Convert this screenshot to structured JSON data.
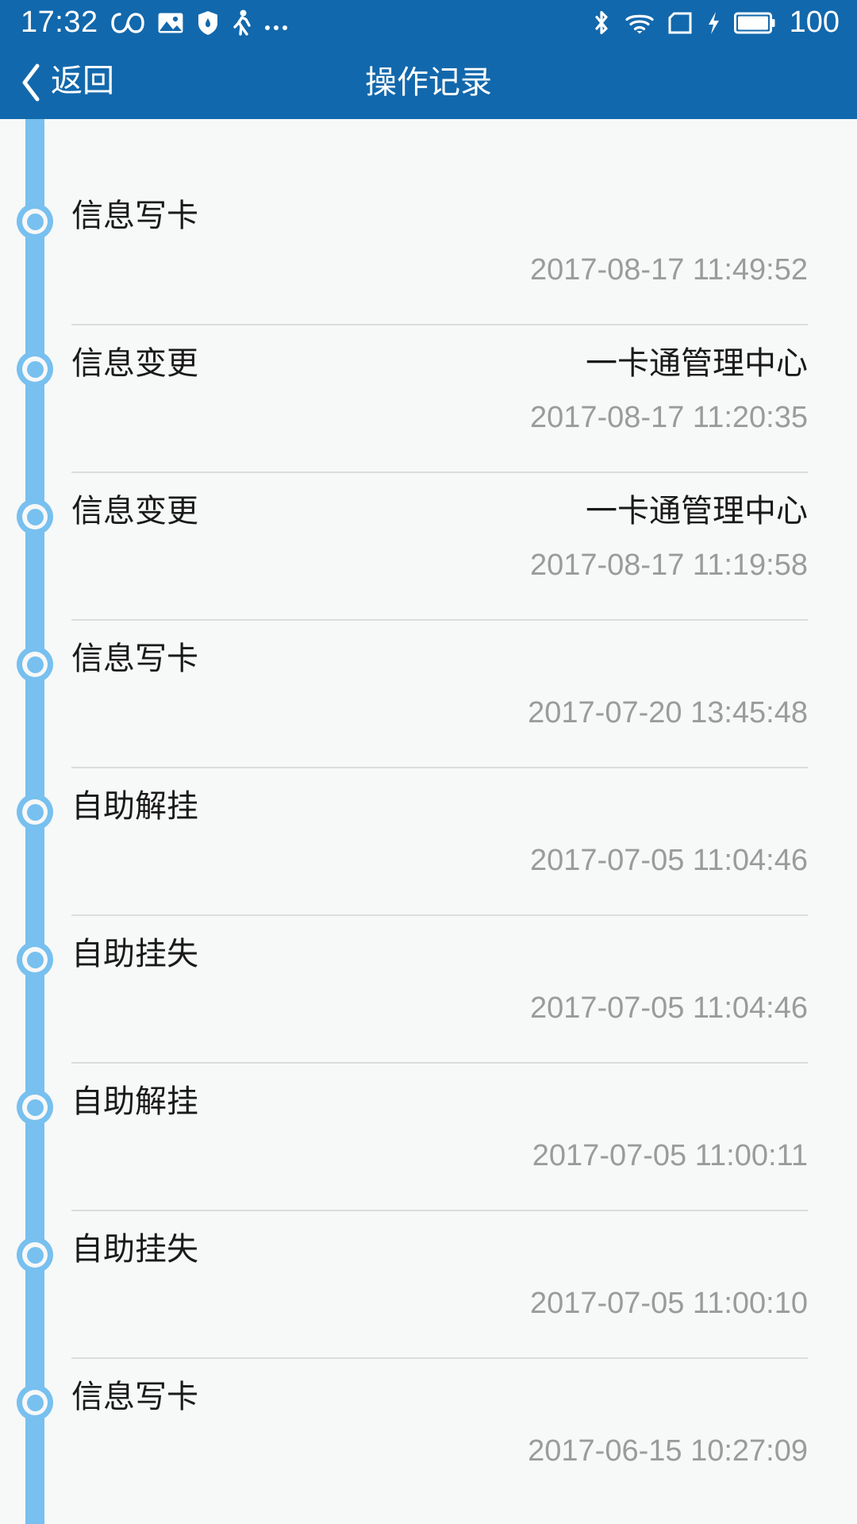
{
  "status_bar": {
    "time": "17:32",
    "battery_percent": "100",
    "left_icons": [
      "infinity-icon",
      "image-icon",
      "shield-icon",
      "pedometer-icon",
      "more-dots-icon"
    ],
    "right_icons": [
      "bluetooth-icon",
      "wifi-icon",
      "sim-card-icon",
      "charging-bolt-icon",
      "battery-icon"
    ],
    "background_color": "#1268ac",
    "foreground_color": "#ffffff"
  },
  "app_bar": {
    "back_label": "返回",
    "title": "操作记录",
    "background_color": "#1268ac",
    "foreground_color": "#ffffff"
  },
  "theme": {
    "timeline_color": "#77c0ef",
    "page_background": "#f7f8f8",
    "divider_color": "#dcdcdc",
    "primary_text_color": "#1a1a1a",
    "secondary_text_color": "#9b9b9b"
  },
  "timeline": {
    "rows": [
      {
        "action": "信息写卡",
        "source": "",
        "time": "2017-08-17 11:49:52"
      },
      {
        "action": "信息变更",
        "source": "一卡通管理中心",
        "time": "2017-08-17 11:20:35"
      },
      {
        "action": "信息变更",
        "source": "一卡通管理中心",
        "time": "2017-08-17 11:19:58"
      },
      {
        "action": "信息写卡",
        "source": "",
        "time": "2017-07-20 13:45:48"
      },
      {
        "action": "自助解挂",
        "source": "",
        "time": "2017-07-05 11:04:46"
      },
      {
        "action": "自助挂失",
        "source": "",
        "time": "2017-07-05 11:04:46"
      },
      {
        "action": "自助解挂",
        "source": "",
        "time": "2017-07-05 11:00:11"
      },
      {
        "action": "自助挂失",
        "source": "",
        "time": "2017-07-05 11:00:10"
      },
      {
        "action": "信息写卡",
        "source": "",
        "time": "2017-06-15 10:27:09"
      }
    ]
  }
}
